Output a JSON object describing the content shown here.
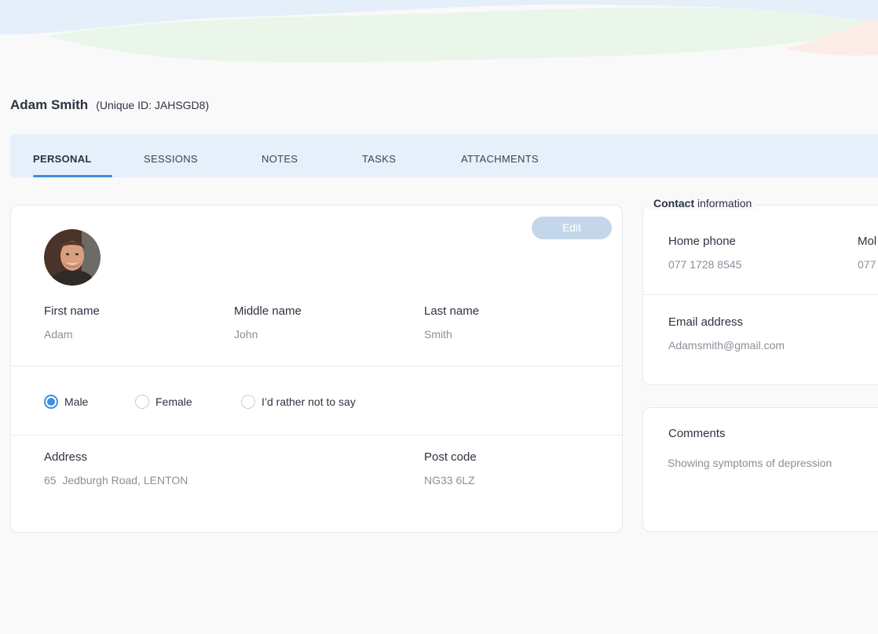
{
  "profile": {
    "name": "Adam Smith",
    "unique_id": "(Unique ID: JAHSGD8)"
  },
  "tabs": [
    {
      "label": "PERSONAL",
      "active": true
    },
    {
      "label": "SESSIONS",
      "active": false
    },
    {
      "label": "NOTES",
      "active": false
    },
    {
      "label": "TASKS",
      "active": false
    },
    {
      "label": "ATTACHMENTS",
      "active": false
    }
  ],
  "personal": {
    "edit_label": "Edit",
    "avatar_icon": "user-photo",
    "first_name": {
      "label": "First name",
      "value": "Adam"
    },
    "middle_name": {
      "label": "Middle name",
      "value": "John"
    },
    "last_name": {
      "label": "Last name",
      "value": "Smith"
    },
    "gender": {
      "options": [
        "Male",
        "Female",
        "I’d rather not to say"
      ],
      "selected": "Male"
    },
    "address": {
      "label": "Address",
      "value": "65  Jedburgh Road, LENTON"
    },
    "post_code": {
      "label": "Post code",
      "value": "NG33 6LZ"
    }
  },
  "contact": {
    "title_bold": "Contact",
    "title_rest": " information",
    "home_phone": {
      "label": "Home phone",
      "value": "077 1728 8545"
    },
    "mobile": {
      "label": "Mol",
      "value": "077"
    },
    "email": {
      "label": "Email address",
      "value": "Adamsmith@gmail.com"
    }
  },
  "comments": {
    "label": "Comments",
    "value": "Showing symptoms of depression"
  },
  "colors": {
    "accent": "#3f8fdd",
    "tab_bar": "#e6f0fb",
    "edit_button": "#c4d7ea",
    "muted_text": "#8a8f99"
  }
}
